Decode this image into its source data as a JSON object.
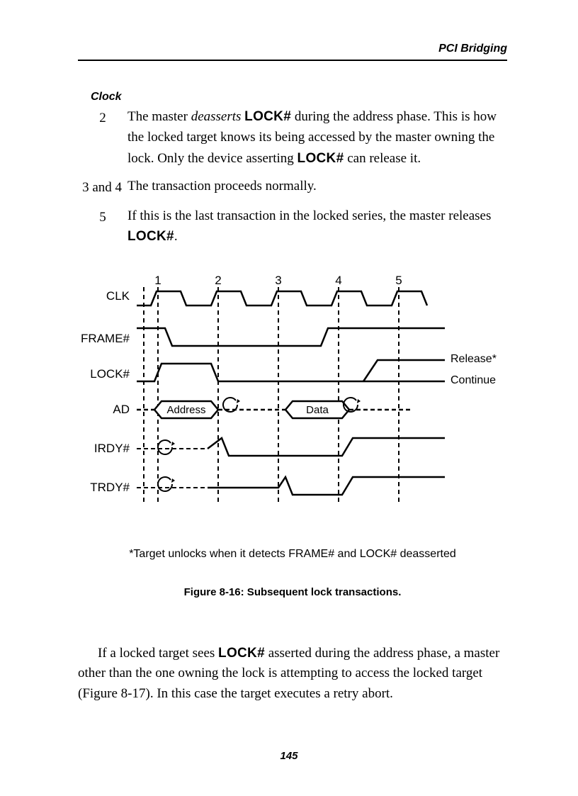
{
  "header": {
    "title": "PCI Bridging"
  },
  "section": {
    "heading": "Clock"
  },
  "entries": [
    {
      "num": "2",
      "text_parts": {
        "a": "The master ",
        "b": "deasserts",
        "c": " ",
        "d": "LOCK#",
        "e": " during the address phase. This is how the locked target knows its being accessed by the master owning the lock. Only the device asserting ",
        "f": "LOCK#",
        "g": " can release it."
      }
    },
    {
      "num": "3 and 4",
      "text_parts": {
        "a": "The transaction proceeds normally."
      }
    },
    {
      "num": "5",
      "text_parts": {
        "a": "If this is the last transaction in the locked series, the master releases ",
        "b": "LOCK#",
        "c": "."
      }
    }
  ],
  "timing": {
    "ticks": [
      "1",
      "2",
      "3",
      "4",
      "5"
    ],
    "signals": [
      "CLK",
      "FRAME#",
      "LOCK#",
      "AD",
      "IRDY#",
      "TRDY#"
    ],
    "bubbles": {
      "address": "Address",
      "data": "Data"
    },
    "annotations": {
      "release": "Release*",
      "continue": "Continue"
    }
  },
  "footnote": "*Target unlocks when it detects FRAME# and LOCK# deasserted",
  "caption": "Figure 8-16:  Subsequent lock transactions.",
  "body": {
    "a": "If a locked target sees ",
    "b": "LOCK#",
    "c": " asserted during the address phase, a master other than the one owning the lock is attempting to access the locked target (Figure 8-17). In this case the target executes a retry abort."
  },
  "page_number": "145"
}
